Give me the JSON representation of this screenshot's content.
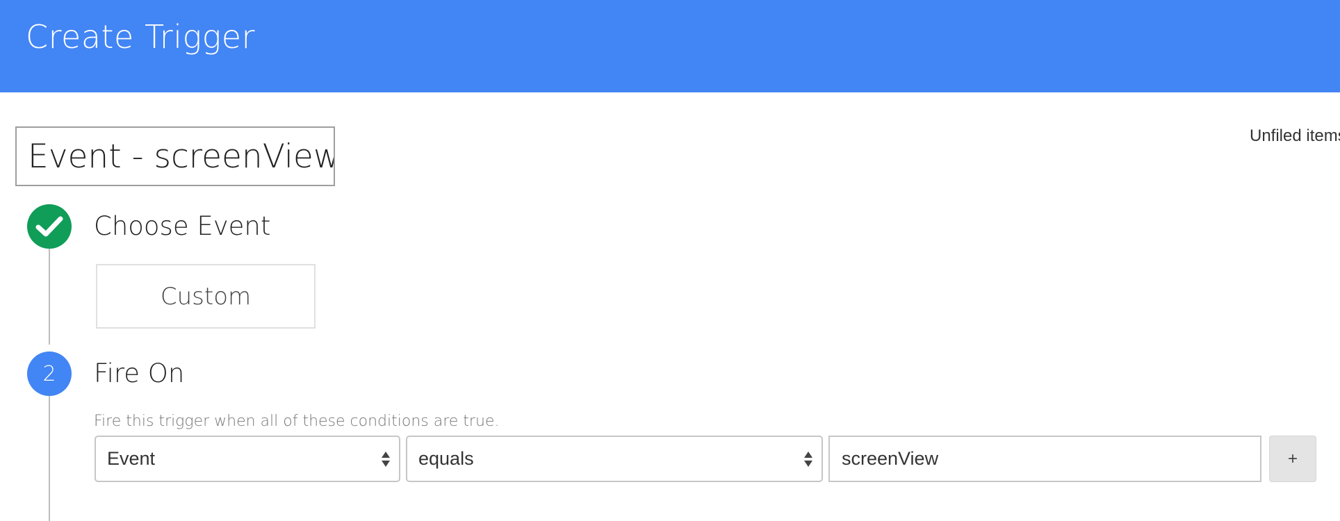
{
  "header": {
    "title": "Create Trigger",
    "bg_color": "#4285f4"
  },
  "trigger": {
    "name": "Event - screenView",
    "folder": "Unfiled items"
  },
  "steps": [
    {
      "status": "complete",
      "icon": "checkmark-icon",
      "color": "#0f9d58",
      "title": "Choose Event",
      "selected_event": "Custom"
    },
    {
      "status": "current",
      "number": "2",
      "color": "#4285f4",
      "title": "Fire On",
      "hint": "Fire this trigger when all of these conditions are true.",
      "condition": {
        "variable": "Event",
        "operator": "equals",
        "value": "screenView",
        "add_label": "+"
      }
    }
  ]
}
